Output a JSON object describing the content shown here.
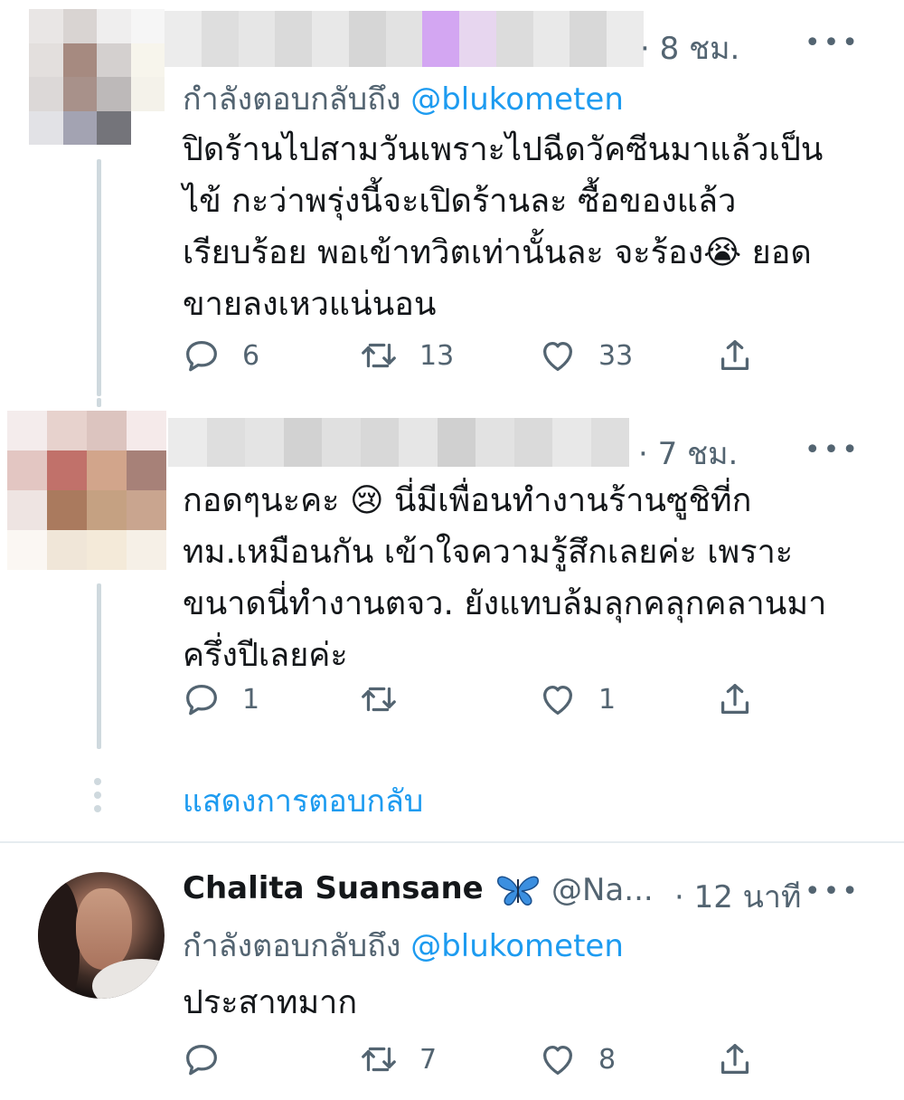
{
  "tweets": [
    {
      "time": "· 8 ชม.",
      "more": "•••",
      "reply_prefix": "กำลังตอบกลับถึง",
      "reply_handle": "@blukometen",
      "text": "ปิดร้านไปสามวันเพราะไปฉีดวัคซีนมาแล้วเป็น\nไข้ กะว่าพรุ่งนี้จะเปิดร้านละ ซื้อของแล้ว\nเรียบร้อย พอเข้าทวิตเท่านั้นละ จะร้อง😭 ยอด\nขายลงเหวแน่นอน",
      "replies": "6",
      "retweets": "13",
      "likes": "33"
    },
    {
      "time": "· 7 ชม.",
      "more": "•••",
      "text": "กอดๆนะคะ 😢 นี่มีเพื่อนทำงานร้านซูชิที่ก\nทม.เหมือนกัน เข้าใจความรู้สึกเลยค่ะ เพราะ\nขนาดนี่ทำงานตจว. ยังแทบล้มลุกคลุกคลานมา\nครึ่งปีเลยค่ะ",
      "replies": "1",
      "retweets": "",
      "likes": "1"
    },
    {
      "name": "Chalita Suansane",
      "handle": "@Na...",
      "time": "· 12 นาที",
      "more": "•••",
      "reply_prefix": "กำลังตอบกลับถึง",
      "reply_handle": "@blukometen",
      "text": "ประสาทมาก",
      "replies": "",
      "retweets": "7",
      "likes": "8"
    }
  ],
  "show_replies": "แสดงการตอบกลับ",
  "colors": {
    "link": "#1d9bf0",
    "secondary": "#536471",
    "thread_line": "#cfd9de"
  }
}
